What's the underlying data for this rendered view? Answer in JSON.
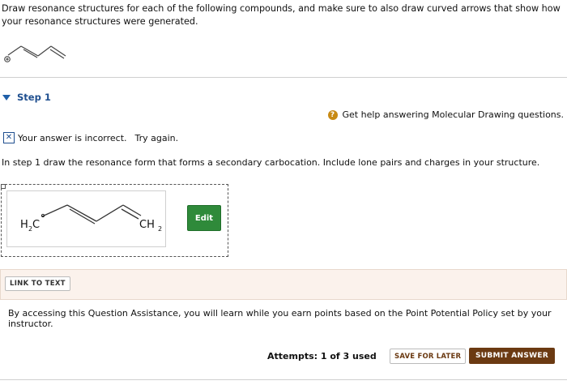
{
  "question": {
    "prompt": "Draw resonance structures for each of the following compounds, and make sure to also draw curved arrows that show how your resonance structures were generated."
  },
  "step": {
    "label": "Step 1"
  },
  "help": {
    "icon": "?",
    "text": "Get help answering Molecular Drawing questions."
  },
  "feedback": {
    "icon": "✕",
    "text": "Your answer is incorrect.",
    "try_again": "Try again."
  },
  "instruction": "In step 1 draw the resonance form that forms a secondary carbocation. Include lone pairs and charges in your structure.",
  "answer_structure": {
    "left_group": "H",
    "left_sub": "2",
    "left_atom": "C",
    "right_group": "CH",
    "right_sub": "2"
  },
  "edit_label": "Edit",
  "link_to_text_label": "LINK TO TEXT",
  "assist_text": "By accessing this Question Assistance, you will learn while you earn points based on the Point Potential Policy set by your instructor.",
  "attempts_text": "Attempts: 1 of 3 used",
  "save_label": "SAVE FOR LATER",
  "submit_label": "SUBMIT ANSWER",
  "colors": {
    "step_blue": "#1f4f8f",
    "edit_green": "#2f8a3a",
    "submit_brown": "#6b3a12",
    "panel_bg": "#fbf2ec"
  }
}
